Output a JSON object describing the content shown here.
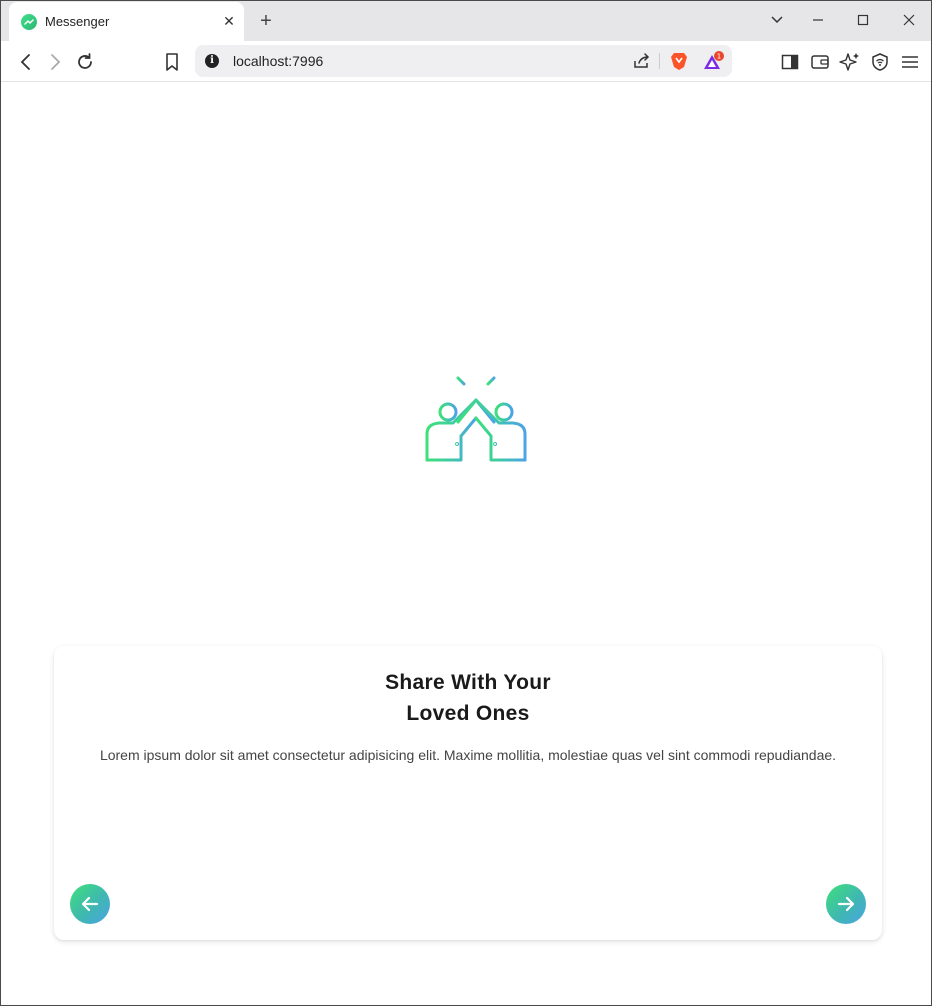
{
  "browser": {
    "tab": {
      "title": "Messenger",
      "close_label": "✕"
    },
    "new_tab_label": "+",
    "window_controls": {
      "dropdown": "⌄",
      "minimize": "—",
      "maximize": "☐",
      "close": "✕"
    },
    "address": {
      "url": "localhost:7996",
      "info_label": "i"
    },
    "rewards_badge": "1"
  },
  "onboarding": {
    "illustration": "high-five-icon",
    "title_line1": "Share With Your",
    "title_line2": "Loved Ones",
    "description": "Lorem ipsum dolor sit amet consectetur adipisicing elit. Maxime mollitia, molestiae quas vel sint commodi repudiandae.",
    "prev_button": "arrow-left-icon",
    "next_button": "arrow-right-icon"
  },
  "colors": {
    "gradient_start": "#3ee07a",
    "gradient_end": "#4aa3e6",
    "title_color": "#1a1a1a",
    "text_color": "#444444"
  }
}
